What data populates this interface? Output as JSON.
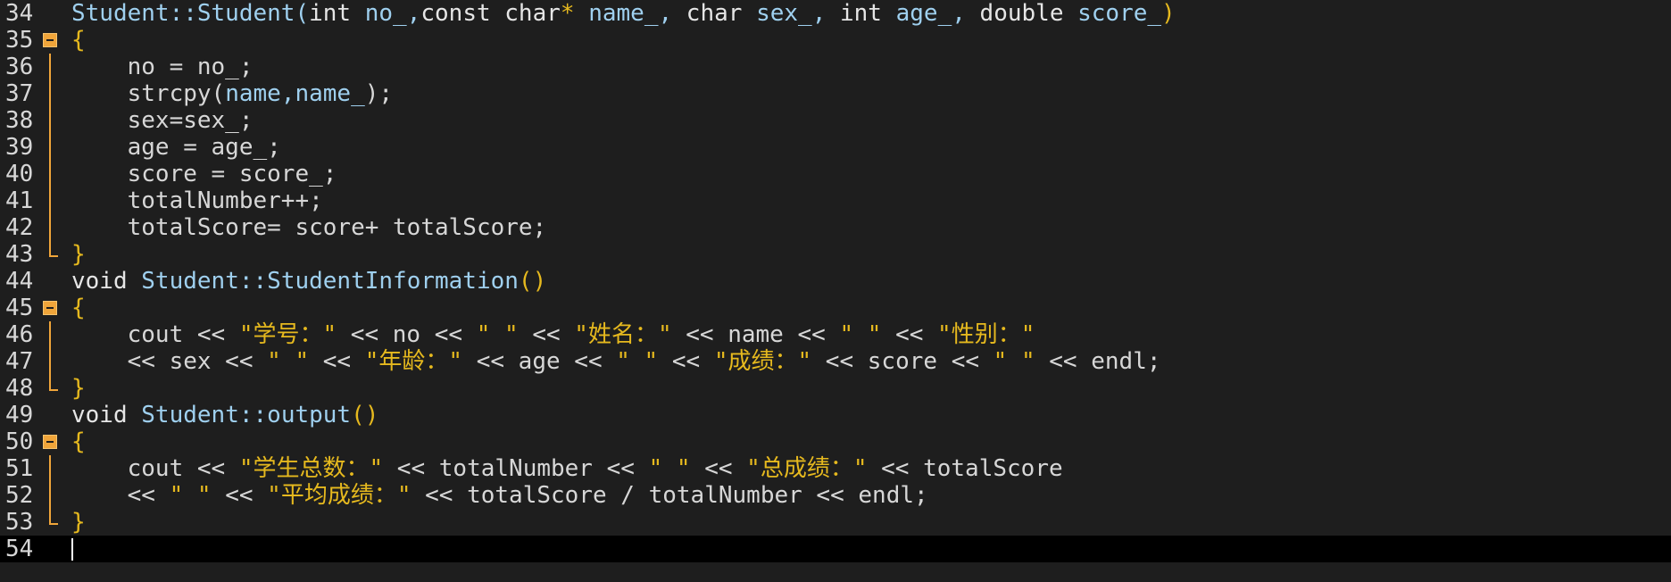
{
  "editor": {
    "lines": [
      {
        "num": "34",
        "fold": "",
        "tokens": [
          {
            "t": "Student::Student(",
            "c": "t-name"
          },
          {
            "t": "int ",
            "c": "t-type"
          },
          {
            "t": "no_,",
            "c": "t-name"
          },
          {
            "t": "const char",
            "c": "t-type"
          },
          {
            "t": "* ",
            "c": "t-str"
          },
          {
            "t": "name_, ",
            "c": "t-name"
          },
          {
            "t": "char ",
            "c": "t-type"
          },
          {
            "t": "sex_, ",
            "c": "t-name"
          },
          {
            "t": "int ",
            "c": "t-type"
          },
          {
            "t": "age_, ",
            "c": "t-name"
          },
          {
            "t": "double ",
            "c": "t-type"
          },
          {
            "t": "score_",
            "c": "t-name"
          },
          {
            "t": ")",
            "c": "t-str"
          }
        ]
      },
      {
        "num": "35",
        "fold": "open",
        "tokens": [
          {
            "t": "{",
            "c": "t-str"
          }
        ]
      },
      {
        "num": "36",
        "fold": "line",
        "tokens": [
          {
            "t": "    no = no_;",
            "c": "t-ident"
          }
        ]
      },
      {
        "num": "37",
        "fold": "line",
        "tokens": [
          {
            "t": "    strcpy(",
            "c": "t-ident"
          },
          {
            "t": "name,name_",
            "c": "t-name"
          },
          {
            "t": ");",
            "c": "t-ident"
          }
        ]
      },
      {
        "num": "38",
        "fold": "line",
        "tokens": [
          {
            "t": "    sex=sex_;",
            "c": "t-ident"
          }
        ]
      },
      {
        "num": "39",
        "fold": "line",
        "tokens": [
          {
            "t": "    age = age_;",
            "c": "t-ident"
          }
        ]
      },
      {
        "num": "40",
        "fold": "line",
        "tokens": [
          {
            "t": "    score = score_;",
            "c": "t-ident"
          }
        ]
      },
      {
        "num": "41",
        "fold": "line",
        "tokens": [
          {
            "t": "    totalNumber++;",
            "c": "t-ident"
          }
        ]
      },
      {
        "num": "42",
        "fold": "line",
        "tokens": [
          {
            "t": "    totalScore= score+ totalScore;",
            "c": "t-ident"
          }
        ]
      },
      {
        "num": "43",
        "fold": "end",
        "tokens": [
          {
            "t": "}",
            "c": "t-str"
          }
        ]
      },
      {
        "num": "44",
        "fold": "",
        "tokens": [
          {
            "t": "void ",
            "c": "t-type"
          },
          {
            "t": "Student::StudentInformation",
            "c": "t-name"
          },
          {
            "t": "()",
            "c": "t-str"
          }
        ]
      },
      {
        "num": "45",
        "fold": "open",
        "tokens": [
          {
            "t": "{",
            "c": "t-str"
          }
        ]
      },
      {
        "num": "46",
        "fold": "line",
        "tokens": [
          {
            "t": "    cout << ",
            "c": "t-ident"
          },
          {
            "t": "\"学号：\"",
            "c": "t-str"
          },
          {
            "t": " << no << ",
            "c": "t-ident"
          },
          {
            "t": "\" \"",
            "c": "t-str"
          },
          {
            "t": " << ",
            "c": "t-ident"
          },
          {
            "t": "\"姓名：\"",
            "c": "t-str"
          },
          {
            "t": " << name << ",
            "c": "t-ident"
          },
          {
            "t": "\" \"",
            "c": "t-str"
          },
          {
            "t": " << ",
            "c": "t-ident"
          },
          {
            "t": "\"性别：\"",
            "c": "t-str"
          }
        ]
      },
      {
        "num": "47",
        "fold": "line",
        "tokens": [
          {
            "t": "    << sex << ",
            "c": "t-ident"
          },
          {
            "t": "\" \"",
            "c": "t-str"
          },
          {
            "t": " << ",
            "c": "t-ident"
          },
          {
            "t": "\"年龄：\"",
            "c": "t-str"
          },
          {
            "t": " << age << ",
            "c": "t-ident"
          },
          {
            "t": "\" \"",
            "c": "t-str"
          },
          {
            "t": " << ",
            "c": "t-ident"
          },
          {
            "t": "\"成绩：\"",
            "c": "t-str"
          },
          {
            "t": " << score << ",
            "c": "t-ident"
          },
          {
            "t": "\" \"",
            "c": "t-str"
          },
          {
            "t": " << endl;",
            "c": "t-ident"
          }
        ]
      },
      {
        "num": "48",
        "fold": "end",
        "tokens": [
          {
            "t": "}",
            "c": "t-str"
          }
        ]
      },
      {
        "num": "49",
        "fold": "",
        "tokens": [
          {
            "t": "void ",
            "c": "t-type"
          },
          {
            "t": "Student::output",
            "c": "t-name"
          },
          {
            "t": "()",
            "c": "t-str"
          }
        ]
      },
      {
        "num": "50",
        "fold": "open",
        "tokens": [
          {
            "t": "{",
            "c": "t-str"
          }
        ]
      },
      {
        "num": "51",
        "fold": "line",
        "tokens": [
          {
            "t": "    cout << ",
            "c": "t-ident"
          },
          {
            "t": "\"学生总数：\"",
            "c": "t-str"
          },
          {
            "t": " << totalNumber << ",
            "c": "t-ident"
          },
          {
            "t": "\" \"",
            "c": "t-str"
          },
          {
            "t": " << ",
            "c": "t-ident"
          },
          {
            "t": "\"总成绩：\"",
            "c": "t-str"
          },
          {
            "t": " << totalScore",
            "c": "t-ident"
          }
        ]
      },
      {
        "num": "52",
        "fold": "line",
        "tokens": [
          {
            "t": "    << ",
            "c": "t-ident"
          },
          {
            "t": "\" \"",
            "c": "t-str"
          },
          {
            "t": " << ",
            "c": "t-ident"
          },
          {
            "t": "\"平均成绩：\"",
            "c": "t-str"
          },
          {
            "t": " << totalScore / totalNumber << endl;",
            "c": "t-ident"
          }
        ]
      },
      {
        "num": "53",
        "fold": "end",
        "tokens": [
          {
            "t": "}",
            "c": "t-str"
          }
        ]
      },
      {
        "num": "54",
        "fold": "",
        "current": true,
        "tokens": [
          {
            "t": "",
            "c": "t-ident"
          }
        ]
      }
    ]
  },
  "colors": {
    "background": "#1e1e1e",
    "current_line": "#000000",
    "fold_marker": "#f0a53a",
    "string": "#e6b91e",
    "identifier": "#d7d7d7",
    "name": "#9fd0ef"
  }
}
